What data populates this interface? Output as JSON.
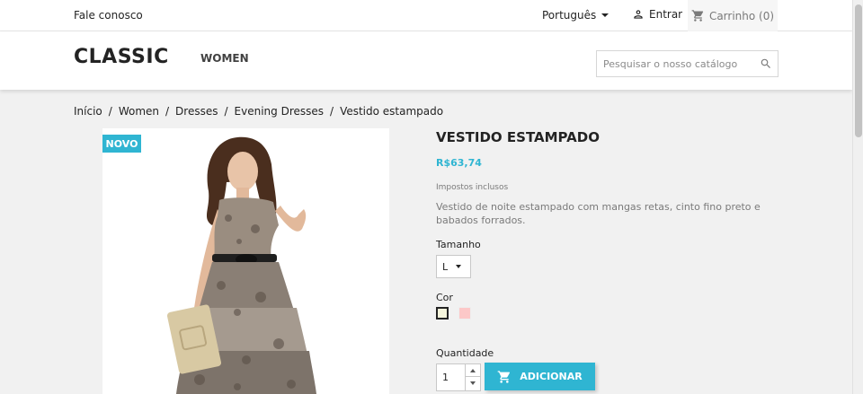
{
  "topnav": {
    "contact": "Fale conosco",
    "language": "Português",
    "login": "Entrar",
    "cart": "Carrinho (0)"
  },
  "header": {
    "logo": "CLASSIC",
    "menu_women": "WOMEN",
    "search_placeholder": "Pesquisar o nosso catálogo"
  },
  "breadcrumb": {
    "items": [
      "Início",
      "Women",
      "Dresses",
      "Evening Dresses",
      "Vestido estampado"
    ],
    "separator": "/"
  },
  "product": {
    "badge": "NOVO",
    "title": "VESTIDO ESTAMPADO",
    "price": "R$63,74",
    "tax_note": "Impostos inclusos",
    "description": "Vestido de noite estampado com mangas retas, cinto fino preto e babados forrados.",
    "size_label": "Tamanho",
    "size_value": "L",
    "color_label": "Cor",
    "colors": [
      "#f5f5dc",
      "#fcc8c8"
    ],
    "quantity_label": "Quantidade",
    "quantity_value": "1",
    "add_button": "ADICIONAR"
  },
  "colors": {
    "accent": "#2fb5d2",
    "text": "#232323",
    "muted": "#7a7a7a",
    "background": "#f1f1f1"
  },
  "icons": [
    "person-icon",
    "cart-icon",
    "search-icon",
    "chevron-down-icon",
    "cart-plus-icon"
  ]
}
